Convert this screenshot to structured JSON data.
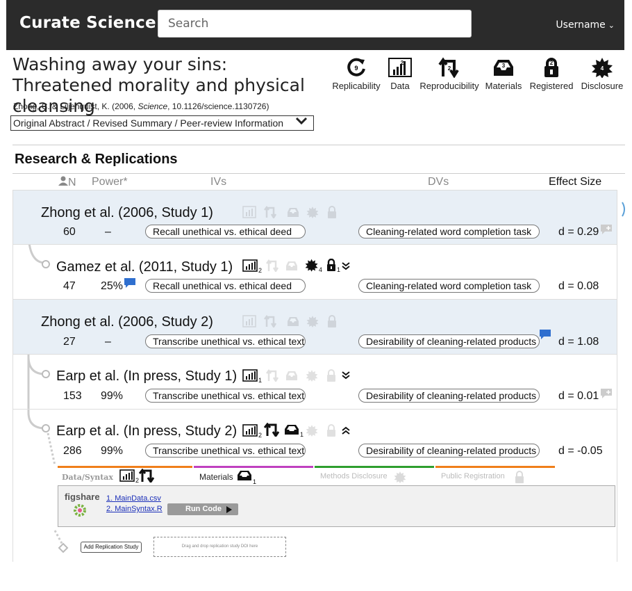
{
  "app": {
    "brand": "Curate Science",
    "search_placeholder": "Search",
    "username": "Username"
  },
  "article": {
    "title": "Washing away your sins: Threatened morality and physical cleansing",
    "authors_prefix": "Zhong, C. & Liljenquist, K. (2006, ",
    "journal": "Science",
    "doi_suffix": ", 10.1126/science.1130726)",
    "toggle_label": "Original Abstract / Revised Summary / Peer-review Information"
  },
  "badges": [
    {
      "label": "Replicability",
      "count": "9",
      "icon": "replicability-icon"
    },
    {
      "label": "Data",
      "count": "2",
      "icon": "data-icon"
    },
    {
      "label": "Reproducibility",
      "count": "2",
      "icon": "reproducibility-icon"
    },
    {
      "label": "Materials",
      "count": "3",
      "icon": "materials-icon"
    },
    {
      "label": "Registered",
      "count": "2",
      "icon": "registered-icon"
    },
    {
      "label": "Disclosure",
      "count": "4",
      "icon": "disclosure-icon"
    }
  ],
  "section_title": "Research & Replications",
  "columns": {
    "n": "N",
    "power": "Power*",
    "ivs": "IVs",
    "dvs": "DVs",
    "effect": "Effect Size"
  },
  "studies": [
    {
      "name": "Zhong et al. (2006, Study 1)",
      "n": "60",
      "power": "–",
      "iv": "Recall unethical vs. ethical deed",
      "dv": "Cleaning-related word completion task",
      "effect": "d = 0.29"
    },
    {
      "name": "Gamez et al. (2011, Study 1)",
      "n": "47",
      "power": "25%",
      "iv": "Recall unethical vs. ethical deed",
      "dv": "Cleaning-related word completion task",
      "effect": "d = 0.08",
      "data_count": "2",
      "disclosure_count": "4",
      "registered_count": "1"
    },
    {
      "name": "Zhong et al. (2006, Study 2)",
      "n": "27",
      "power": "–",
      "iv": "Transcribe unethical vs. ethical text",
      "dv": "Desirability of cleaning-related products",
      "effect": "d = 1.08"
    },
    {
      "name": "Earp et al. (In press, Study 1)",
      "n": "153",
      "power": "99%",
      "iv": "Transcribe unethical vs. ethical text",
      "dv": "Desirability of cleaning-related products",
      "effect": "d = 0.01",
      "data_count": "1"
    },
    {
      "name": "Earp et al. (In press, Study 2)",
      "n": "286",
      "power": "99%",
      "iv": "Transcribe unethical vs. ethical text",
      "dv": "Desirability of cleaning-related products",
      "effect": "d = -0.05",
      "data_count": "2",
      "materials_count": "1"
    }
  ],
  "tabs": {
    "data_syntax": "Data/Syntax",
    "data_syntax_count": "2",
    "materials": "Materials",
    "materials_count": "1",
    "methods": "Methods Disclosure",
    "registration": "Public Registration"
  },
  "files": {
    "provider": "figshare",
    "items": [
      "1. MainData.csv",
      "2. MainSyntax.R"
    ],
    "run_label": "Run Code"
  },
  "footer": {
    "add_button": "Add Replication Study",
    "drop_hint": "Drag and drop replication study DOI here"
  },
  "colors": {
    "topbar": "#2b2b2b",
    "original_row": "#e8eff6",
    "tab_data": "#f07f1a",
    "tab_materials": "#c040c0",
    "tab_methods": "#2e9e2e",
    "tab_registration": "#f07f1a",
    "comment_blue": "#2f6fcf"
  }
}
